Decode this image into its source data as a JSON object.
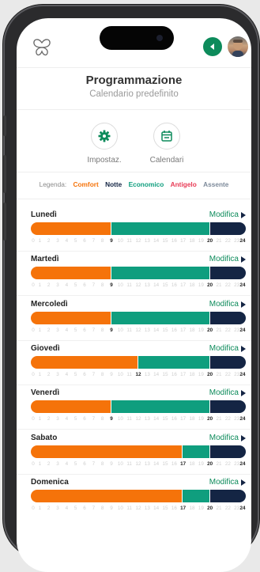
{
  "header": {
    "title": "Programmazione",
    "subtitle": "Calendario predefinito",
    "logo_icon": "butterfly-logo-icon",
    "back_icon": "chevron-left-icon"
  },
  "actions": [
    {
      "label": "Impostaz.",
      "icon": "gear-icon"
    },
    {
      "label": "Calendari",
      "icon": "calendar-icon"
    }
  ],
  "legend": {
    "label": "Legenda:",
    "items": [
      {
        "name": "Comfort",
        "color": "#f5730a"
      },
      {
        "name": "Notte",
        "color": "#142544"
      },
      {
        "name": "Economico",
        "color": "#0f9e7e"
      },
      {
        "name": "Antigelo",
        "color": "#e83a55"
      },
      {
        "name": "Assente",
        "color": "#7d8a9a"
      }
    ]
  },
  "modifica_label": "Modifica",
  "colors": {
    "comfort": "#f5730a",
    "economico": "#0f9e7e",
    "notte": "#142544"
  },
  "days": [
    {
      "name": "Lunedì",
      "segments": [
        {
          "mode": "comfort",
          "start": 0,
          "end": 9
        },
        {
          "mode": "economico",
          "start": 9,
          "end": 20
        },
        {
          "mode": "notte",
          "start": 20,
          "end": 24
        }
      ]
    },
    {
      "name": "Martedì",
      "segments": [
        {
          "mode": "comfort",
          "start": 0,
          "end": 9
        },
        {
          "mode": "economico",
          "start": 9,
          "end": 20
        },
        {
          "mode": "notte",
          "start": 20,
          "end": 24
        }
      ]
    },
    {
      "name": "Mercoledì",
      "segments": [
        {
          "mode": "comfort",
          "start": 0,
          "end": 9
        },
        {
          "mode": "economico",
          "start": 9,
          "end": 20
        },
        {
          "mode": "notte",
          "start": 20,
          "end": 24
        }
      ]
    },
    {
      "name": "Giovedì",
      "segments": [
        {
          "mode": "comfort",
          "start": 0,
          "end": 12
        },
        {
          "mode": "economico",
          "start": 12,
          "end": 20
        },
        {
          "mode": "notte",
          "start": 20,
          "end": 24
        }
      ]
    },
    {
      "name": "Venerdì",
      "segments": [
        {
          "mode": "comfort",
          "start": 0,
          "end": 9
        },
        {
          "mode": "economico",
          "start": 9,
          "end": 20
        },
        {
          "mode": "notte",
          "start": 20,
          "end": 24
        }
      ]
    },
    {
      "name": "Sabato",
      "segments": [
        {
          "mode": "comfort",
          "start": 0,
          "end": 17
        },
        {
          "mode": "economico",
          "start": 17,
          "end": 20
        },
        {
          "mode": "notte",
          "start": 20,
          "end": 24
        }
      ]
    },
    {
      "name": "Domenica",
      "segments": [
        {
          "mode": "comfort",
          "start": 0,
          "end": 17
        },
        {
          "mode": "economico",
          "start": 17,
          "end": 20
        },
        {
          "mode": "notte",
          "start": 20,
          "end": 24
        }
      ]
    }
  ]
}
